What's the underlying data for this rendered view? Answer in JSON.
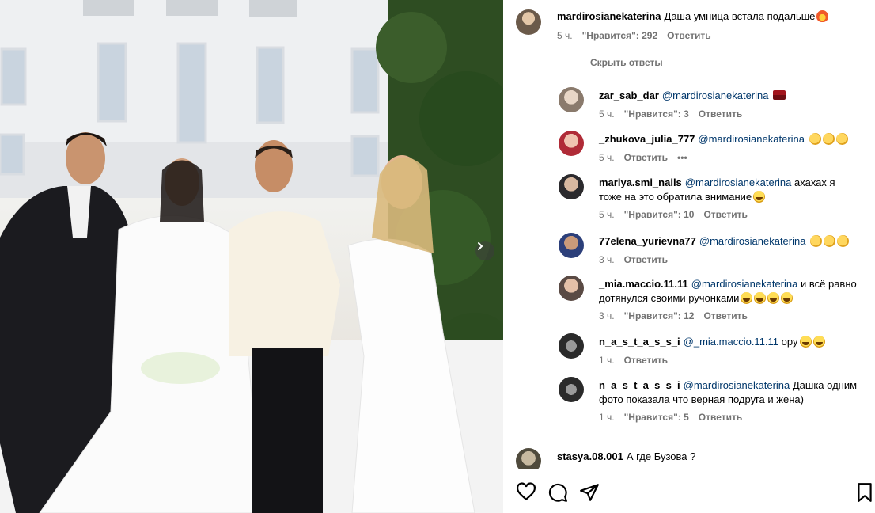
{
  "post_caption": {
    "username": "mardirosianekaterina",
    "text": "Даша умница встала подальше",
    "emoji": "fire",
    "time": "5 ч.",
    "likes": "\"Нравится\": 292",
    "reply": "Ответить"
  },
  "hide_replies_label": "Скрыть ответы",
  "replies": [
    {
      "username": "zar_sab_dar",
      "mention": "@mardirosianekaterina",
      "text": "",
      "emojis": [
        "flag"
      ],
      "time": "5 ч.",
      "likes": "\"Нравится\": 3",
      "reply": "Ответить",
      "more": ""
    },
    {
      "username": "_zhukova_julia_777",
      "mention": "@mardirosianekaterina",
      "text": "",
      "emojis": [
        "clap",
        "clap",
        "clap"
      ],
      "time": "5 ч.",
      "likes": "",
      "reply": "Ответить",
      "more": "•••"
    },
    {
      "username": "mariya.smi_nails",
      "mention": "@mardirosianekaterina",
      "text": "ахахах я",
      "text2": "тоже на это обратила внимание",
      "emojis": [
        "lol"
      ],
      "time": "5 ч.",
      "likes": "\"Нравится\": 10",
      "reply": "Ответить",
      "more": ""
    },
    {
      "username": "77elena_yurievna77",
      "mention": "@mardirosianekaterina",
      "text": "",
      "emojis": [
        "clap",
        "clap",
        "clap"
      ],
      "time": "3 ч.",
      "likes": "",
      "reply": "Ответить",
      "more": ""
    },
    {
      "username": "_mia.maccio.11.11",
      "mention": "@mardirosianekaterina",
      "text": "и всё равно",
      "text2": "дотянулся своими ручонками",
      "emojis": [
        "lol",
        "lol",
        "lol",
        "lol"
      ],
      "time": "3 ч.",
      "likes": "\"Нравится\": 12",
      "reply": "Ответить",
      "more": ""
    },
    {
      "username": "n_a_s_t_a_s_s_i",
      "mention": "@_mia.maccio.11.11",
      "text": "ору",
      "emojis": [
        "lol",
        "lol"
      ],
      "time": "1 ч.",
      "likes": "",
      "reply": "Ответить",
      "more": ""
    },
    {
      "username": "n_a_s_t_a_s_s_i",
      "mention": "@mardirosianekaterina",
      "text": "Дашка одним",
      "text2": "фото показала что верная подруга и жена)",
      "emojis": [],
      "time": "1 ч.",
      "likes": "\"Нравится\": 5",
      "reply": "Ответить",
      "more": ""
    }
  ],
  "last_comment": {
    "username": "stasya.08.001",
    "text": "А где Бузова ?"
  },
  "icons": {
    "like": "heart-icon",
    "comment": "comment-icon",
    "share": "send-icon",
    "save": "bookmark-icon",
    "next": "chevron-right-icon"
  },
  "colors": {
    "mention": "#00376b",
    "meta": "#737373",
    "divider": "#dbdbdb"
  }
}
